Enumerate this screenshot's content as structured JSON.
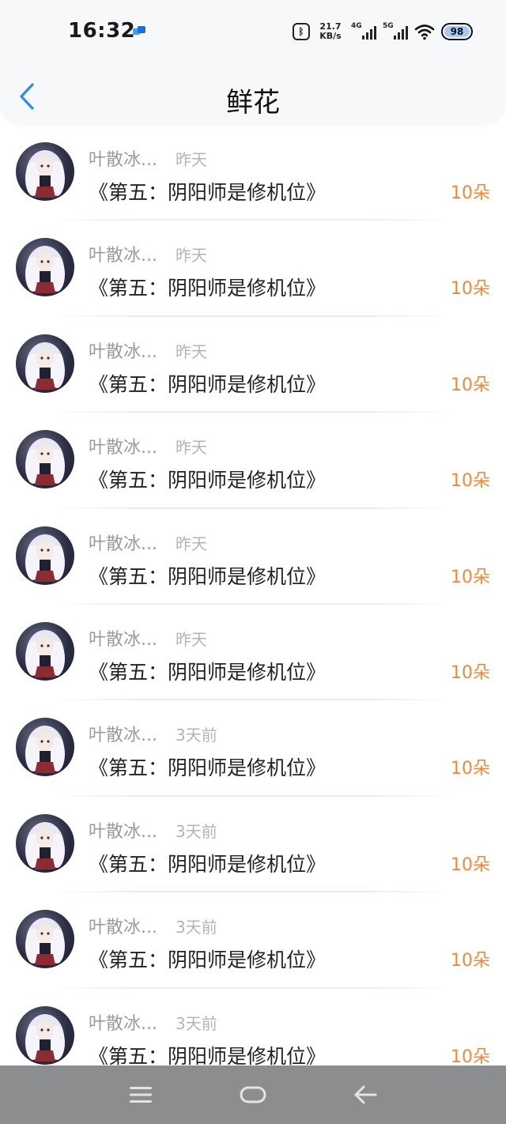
{
  "status_bar": {
    "time": "16:32",
    "net_speed_value": "21.7",
    "net_speed_unit": "KB/s",
    "sim1_label": "4G",
    "sim2_label": "5G",
    "battery": "98"
  },
  "header": {
    "title": "鲜花"
  },
  "accent_color": "#f0883a",
  "back_color": "#2a8cf0",
  "rows": [
    {
      "name": "叶散冰...",
      "date": "昨天",
      "book": "《第五：阴阳师是修机位》",
      "amount": "10朵"
    },
    {
      "name": "叶散冰...",
      "date": "昨天",
      "book": "《第五：阴阳师是修机位》",
      "amount": "10朵"
    },
    {
      "name": "叶散冰...",
      "date": "昨天",
      "book": "《第五：阴阳师是修机位》",
      "amount": "10朵"
    },
    {
      "name": "叶散冰...",
      "date": "昨天",
      "book": "《第五：阴阳师是修机位》",
      "amount": "10朵"
    },
    {
      "name": "叶散冰...",
      "date": "昨天",
      "book": "《第五：阴阳师是修机位》",
      "amount": "10朵"
    },
    {
      "name": "叶散冰...",
      "date": "昨天",
      "book": "《第五：阴阳师是修机位》",
      "amount": "10朵"
    },
    {
      "name": "叶散冰...",
      "date": "3天前",
      "book": "《第五：阴阳师是修机位》",
      "amount": "10朵"
    },
    {
      "name": "叶散冰...",
      "date": "3天前",
      "book": "《第五：阴阳师是修机位》",
      "amount": "10朵"
    },
    {
      "name": "叶散冰...",
      "date": "3天前",
      "book": "《第五：阴阳师是修机位》",
      "amount": "10朵"
    },
    {
      "name": "叶散冰...",
      "date": "3天前",
      "book": "《第五：阴阳师是修机位》",
      "amount": "10朵"
    }
  ],
  "icons": {
    "back": "chevron-left-icon",
    "nav_menu": "menu-icon",
    "nav_home": "home-icon",
    "nav_back": "arrow-left-icon"
  }
}
